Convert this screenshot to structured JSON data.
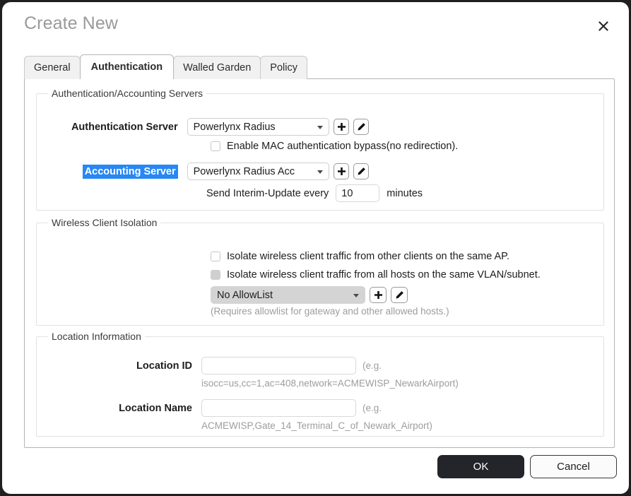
{
  "dialog": {
    "title": "Create New",
    "close_icon": "close-x-icon"
  },
  "tabs": [
    {
      "label": "General",
      "active": false
    },
    {
      "label": "Authentication",
      "active": true
    },
    {
      "label": "Walled Garden",
      "active": false
    },
    {
      "label": "Policy",
      "active": false
    }
  ],
  "auth_section": {
    "legend": "Authentication/Accounting Servers",
    "auth_server": {
      "label": "Authentication Server",
      "value": "Powerlynx Radius",
      "add_icon": "plus-icon",
      "edit_icon": "pencil-icon"
    },
    "mac_bypass": {
      "label": "Enable MAC authentication bypass(no redirection).",
      "checked": false
    },
    "accounting_server": {
      "label": "Accounting Server",
      "label_selected": true,
      "value": "Powerlynx Radius Acc",
      "add_icon": "plus-icon",
      "edit_icon": "pencil-icon"
    },
    "interim_update": {
      "prefix": "Send Interim-Update every",
      "value": "10",
      "suffix": "minutes"
    }
  },
  "isolation_section": {
    "legend": "Wireless Client Isolation",
    "isolate_ap": {
      "label": "Isolate wireless client traffic from other clients on the same AP.",
      "checked": false,
      "disabled": false
    },
    "isolate_vlan": {
      "label": "Isolate wireless client traffic from all hosts on the same VLAN/subnet.",
      "checked": false,
      "disabled": true
    },
    "allowlist": {
      "value": "No AllowList",
      "disabled": true,
      "add_icon": "plus-icon",
      "edit_icon": "pencil-icon"
    },
    "allowlist_hint": "(Requires allowlist for gateway and other allowed hosts.)"
  },
  "location_section": {
    "legend": "Location Information",
    "location_id": {
      "label": "Location ID",
      "value": "",
      "placeholder": "",
      "hint_inline": "(e.g.",
      "hint_below": "isocc=us,cc=1,ac=408,network=ACMEWISP_NewarkAirport)"
    },
    "location_name": {
      "label": "Location Name",
      "value": "",
      "placeholder": "",
      "hint_inline": "(e.g.",
      "hint_below": "ACMEWISP,Gate_14_Terminal_C_of_Newark_Airport)"
    }
  },
  "footer": {
    "ok_label": "OK",
    "cancel_label": "Cancel"
  },
  "colors": {
    "accent_selection": "#2787f5",
    "ok_button_bg": "#24252a",
    "title_text": "#9a9a9a"
  }
}
